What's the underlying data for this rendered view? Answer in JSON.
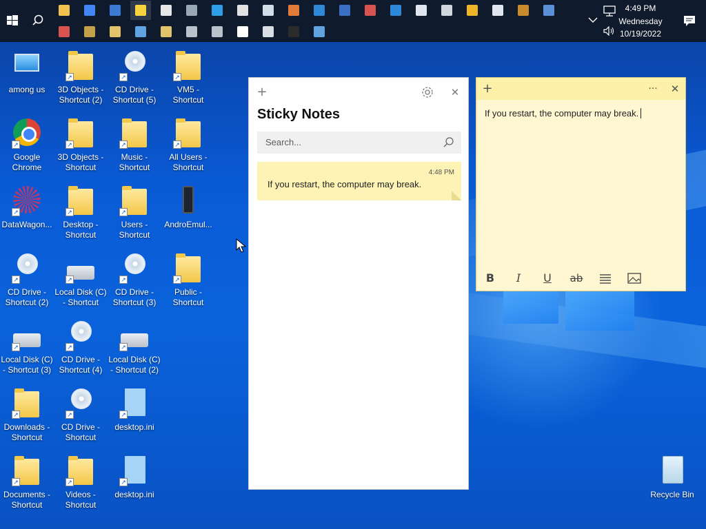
{
  "taskbar": {
    "start_icon": "windows-logo-icon",
    "search_icon": "search-icon",
    "row1_apps": [
      {
        "name": "file-explorer",
        "color": "#f2c14e"
      },
      {
        "name": "chrome",
        "color": "#4285f4"
      },
      {
        "name": "image-viewer",
        "color": "#3b7bd6"
      },
      {
        "name": "sticky-notes",
        "color": "#f7d33f",
        "active": true
      },
      {
        "name": "settings",
        "color": "#e6e6e6"
      },
      {
        "name": "network",
        "color": "#9aa7b5"
      },
      {
        "name": "internet-explorer",
        "color": "#2f9ee8"
      },
      {
        "name": "paint",
        "color": "#e2e2e2"
      },
      {
        "name": "notepad",
        "color": "#d3dde8"
      },
      {
        "name": "palette",
        "color": "#e07b39"
      },
      {
        "name": "remote-desktop",
        "color": "#2e8ad8"
      },
      {
        "name": "media-player",
        "color": "#3a6fc3"
      },
      {
        "name": "snipping-tool",
        "color": "#d9534f"
      },
      {
        "name": "app-grid",
        "color": "#2e8ad8"
      },
      {
        "name": "calendar",
        "color": "#e0e6ee"
      },
      {
        "name": "printer",
        "color": "#cfd6de"
      },
      {
        "name": "video",
        "color": "#f0b429"
      },
      {
        "name": "document",
        "color": "#dfe6ee"
      },
      {
        "name": "vlc-like",
        "color": "#c98a2b"
      },
      {
        "name": "control-panel",
        "color": "#5b8fd6"
      }
    ],
    "row2_apps": [
      {
        "name": "archive",
        "color": "#d9534f"
      },
      {
        "name": "drive",
        "color": "#c2a14a"
      },
      {
        "name": "registry",
        "color": "#e0c36a"
      },
      {
        "name": "magnifier",
        "color": "#5fa3e0"
      },
      {
        "name": "notes-lock",
        "color": "#e0c36a"
      },
      {
        "name": "disk-management",
        "color": "#b9c1cb"
      },
      {
        "name": "scanner",
        "color": "#b9c1cb"
      },
      {
        "name": "no-entry",
        "color": "#ffffff"
      },
      {
        "name": "admin-tools",
        "color": "#d8dde3"
      },
      {
        "name": "command-prompt",
        "color": "#2b2b2b"
      },
      {
        "name": "monitor",
        "color": "#5fa3e0"
      }
    ],
    "tray": {
      "chevron_icon": "chevron-up-icon",
      "network_icon": "network-icon",
      "volume_icon": "volume-icon",
      "notification_icon": "notification-icon",
      "time": "4:49 PM",
      "day": "Wednesday",
      "date": "10/19/2022"
    }
  },
  "desktop_icons": [
    {
      "label": "among us",
      "kind": "pc"
    },
    {
      "label": "3D Objects - Shortcut (2)",
      "kind": "folder"
    },
    {
      "label": "CD Drive - Shortcut (5)",
      "kind": "cd"
    },
    {
      "label": "VM5 - Shortcut",
      "kind": "folder"
    },
    {
      "label": "Google Chrome",
      "kind": "chrome"
    },
    {
      "label": "3D Objects - Shortcut",
      "kind": "folder"
    },
    {
      "label": "Music - Shortcut",
      "kind": "folder"
    },
    {
      "label": "All Users - Shortcut",
      "kind": "folder"
    },
    {
      "label": "DataWagon...",
      "kind": "wagon"
    },
    {
      "label": "Desktop - Shortcut",
      "kind": "folder"
    },
    {
      "label": "Users - Shortcut",
      "kind": "folder"
    },
    {
      "label": "AndroEmul...",
      "kind": "phone"
    },
    {
      "label": "CD Drive - Shortcut (2)",
      "kind": "cd"
    },
    {
      "label": "Local Disk (C) - Shortcut",
      "kind": "disk"
    },
    {
      "label": "CD Drive - Shortcut (3)",
      "kind": "cd"
    },
    {
      "label": "Public - Shortcut",
      "kind": "folder"
    },
    {
      "label": "Local Disk (C) - Shortcut (3)",
      "kind": "disk"
    },
    {
      "label": "CD Drive - Shortcut (4)",
      "kind": "cd"
    },
    {
      "label": "Local Disk (C) - Shortcut (2)",
      "kind": "disk"
    },
    {
      "label": "Downloads - Shortcut",
      "kind": "folder"
    },
    {
      "label": "CD Drive - Shortcut",
      "kind": "cd"
    },
    {
      "label": "desktop.ini",
      "kind": "file"
    },
    {
      "label": "Documents - Shortcut",
      "kind": "folder"
    },
    {
      "label": "Videos - Shortcut",
      "kind": "folder"
    },
    {
      "label": "desktop.ini",
      "kind": "file"
    }
  ],
  "recycle_bin": {
    "label": "Recycle Bin"
  },
  "sticky_list": {
    "add_icon": "+",
    "settings_icon": "gear-icon",
    "close_icon": "✕",
    "title": "Sticky Notes",
    "search_placeholder": "Search...",
    "notes": [
      {
        "time": "4:48 PM",
        "text": "If you restart, the computer may break."
      }
    ]
  },
  "sticky_note": {
    "add_icon": "+",
    "menu_icon": "···",
    "close_icon": "✕",
    "text": "If you restart, the computer may break.",
    "format": {
      "bold": "B",
      "italic": "I",
      "underline": "U",
      "strike": "ab",
      "list_icon": "list-icon",
      "image_icon": "image-icon"
    },
    "colors": {
      "body": "#fff7d1",
      "bar": "#fdf0a8"
    }
  }
}
